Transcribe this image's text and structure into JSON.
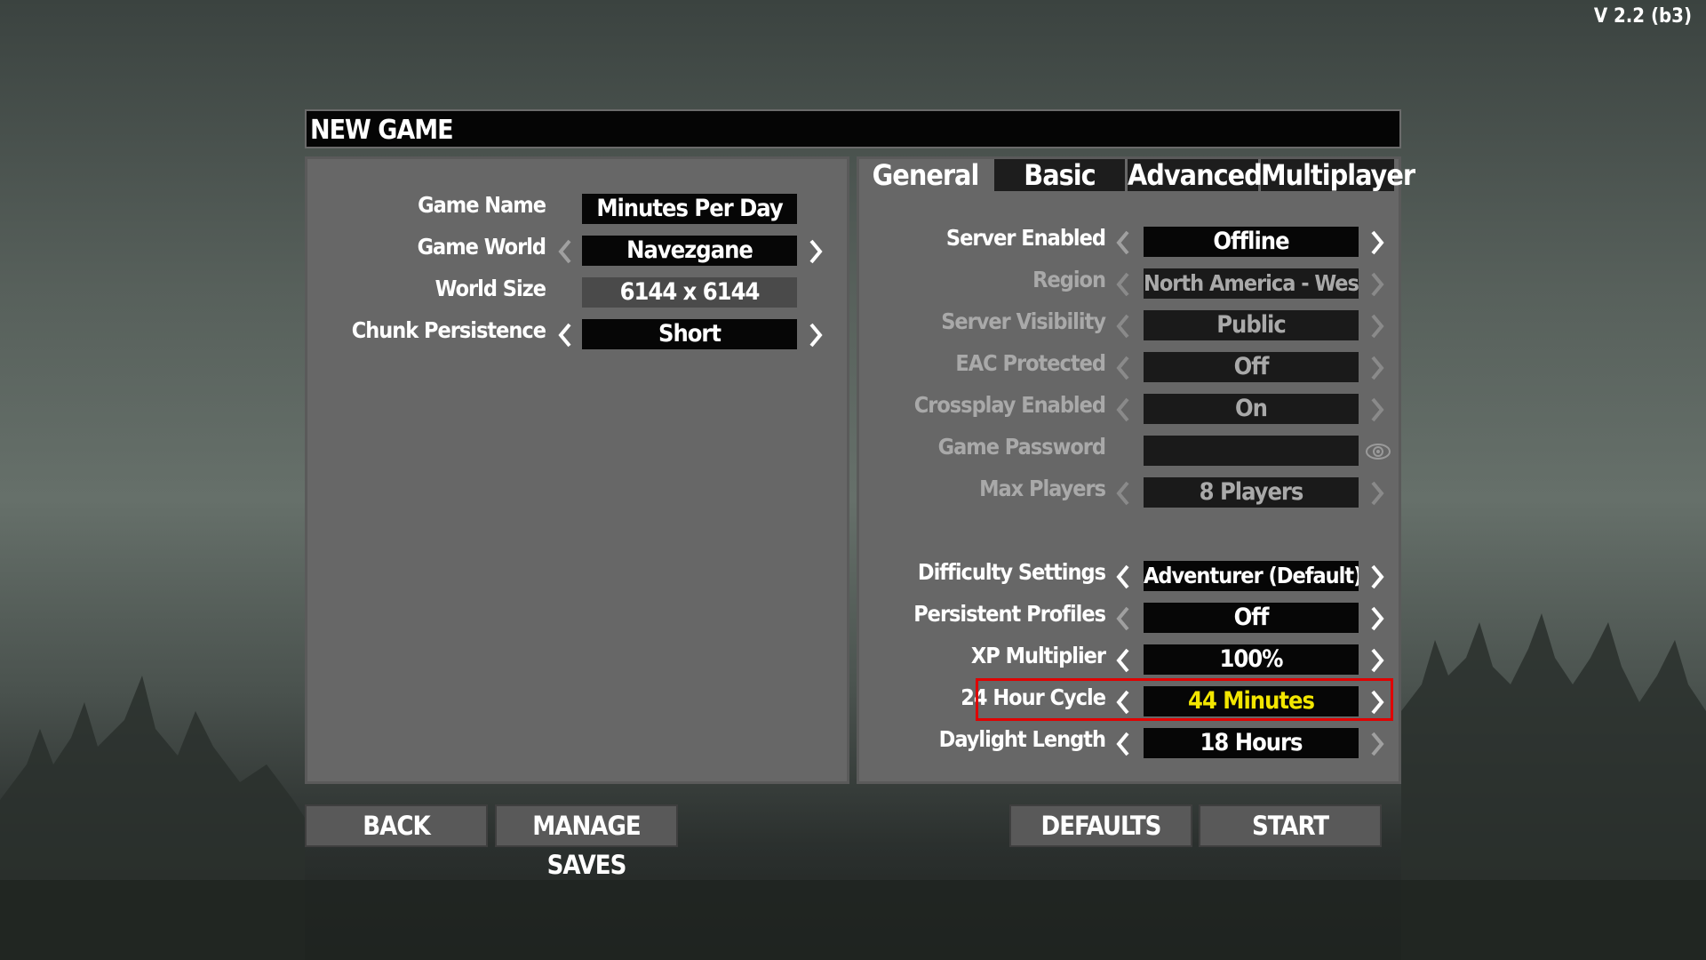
{
  "version": "V 2.2 (b3)",
  "title": "NEW GAME",
  "tabs": [
    "General",
    "Basic",
    "Advanced",
    "Multiplayer"
  ],
  "left": {
    "game_name": {
      "label": "Game Name",
      "value": "Minutes Per Day"
    },
    "game_world": {
      "label": "Game World",
      "value": "Navezgane"
    },
    "world_size": {
      "label": "World Size",
      "value": "6144 x 6144"
    },
    "chunk_persistence": {
      "label": "Chunk Persistence",
      "value": "Short"
    }
  },
  "right": {
    "server_enabled": {
      "label": "Server Enabled",
      "value": "Offline"
    },
    "region": {
      "label": "Region",
      "value": "North America - West"
    },
    "server_visibility": {
      "label": "Server Visibility",
      "value": "Public"
    },
    "eac_protected": {
      "label": "EAC Protected",
      "value": "Off"
    },
    "crossplay_enabled": {
      "label": "Crossplay Enabled",
      "value": "On"
    },
    "game_password": {
      "label": "Game Password",
      "value": ""
    },
    "max_players": {
      "label": "Max Players",
      "value": "8 Players"
    },
    "difficulty": {
      "label": "Difficulty Settings",
      "value": "Adventurer (Default)"
    },
    "persistent_profiles": {
      "label": "Persistent Profiles",
      "value": "Off"
    },
    "xp_multiplier": {
      "label": "XP Multiplier",
      "value": "100%"
    },
    "hour_cycle": {
      "label": "24 Hour Cycle",
      "value": "44 Minutes"
    },
    "daylight_length": {
      "label": "Daylight Length",
      "value": "18 Hours"
    }
  },
  "buttons": {
    "back": "BACK",
    "manage_saves": "MANAGE SAVES",
    "defaults": "DEFAULTS",
    "start": "START"
  },
  "colors": {
    "highlight": "#e00000",
    "selected_value": "#f2e600",
    "panel": "#676767"
  }
}
